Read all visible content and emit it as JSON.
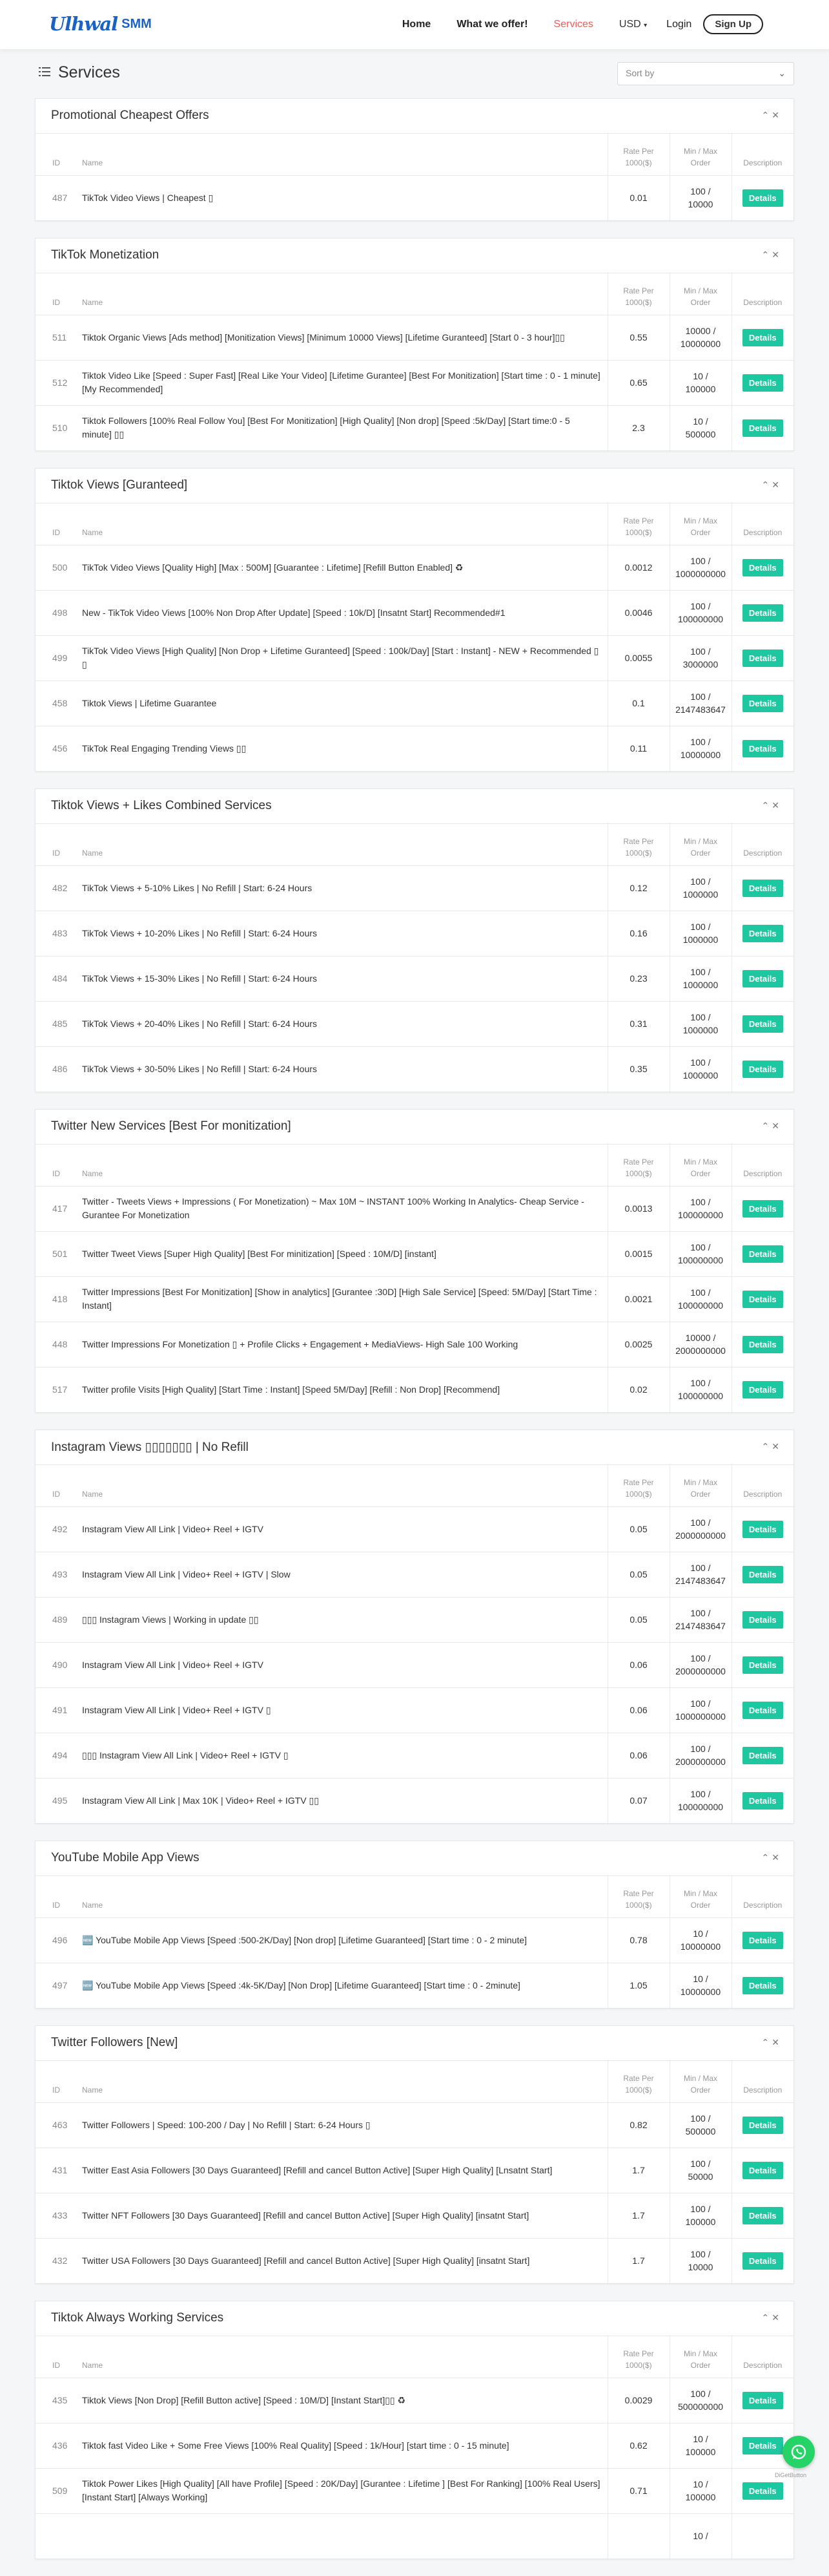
{
  "brand": {
    "script": "Ulhwal",
    "suffix": "SMM",
    "color": "#1b62c4"
  },
  "nav": {
    "home": "Home",
    "offer": "What we offer!",
    "services": "Services",
    "currency": "USD",
    "login": "Login",
    "signup": "Sign Up"
  },
  "page": {
    "title": "Services",
    "sort_placeholder": "Sort by"
  },
  "columns": {
    "id": "ID",
    "name": "Name",
    "rate": "Rate Per 1000($)",
    "minmax": "Min / Max Order",
    "desc": "Description"
  },
  "details_label": "Details",
  "colors": {
    "accent": "#1ec79f",
    "active_nav": "#f05a5a",
    "whatsapp": "#25d366"
  },
  "whatsapp_caption": "DiGetButton",
  "categories": [
    {
      "title": "Promotional Cheapest Offers",
      "rows": [
        {
          "id": "487",
          "name": "TikTok Video Views | Cheapest ▯",
          "rate": "0.01",
          "min": "100 /",
          "max": "10000"
        }
      ]
    },
    {
      "title": "TikTok Monetization",
      "rows": [
        {
          "id": "511",
          "name": "Tiktok Organic Views [Ads method] [Monitization Views] [Minimum 10000 Views] [Lifetime Guranteed] [Start 0 - 3 hour]▯▯",
          "rate": "0.55",
          "min": "10000 /",
          "max": "10000000"
        },
        {
          "id": "512",
          "name": "Tiktok Video Like [Speed : Super Fast] [Real Like Your Video] [Lifetime Gurantee] [Best For Monitization] [Start time : 0 - 1 minute] [My Recommended]",
          "rate": "0.65",
          "min": "10 /",
          "max": "100000"
        },
        {
          "id": "510",
          "name": "Tiktok Followers [100% Real Follow You] [Best For Monitization] [High Quality] [Non drop] [Speed :5k/Day] [Start time:0 - 5 minute] ▯▯",
          "rate": "2.3",
          "min": "10 /",
          "max": "500000"
        }
      ]
    },
    {
      "title": "Tiktok Views [Guranteed]",
      "rows": [
        {
          "id": "500",
          "name": "TikTok Video Views [Quality High] [Max : 500M] [Guarantee : Lifetime] [Refill Button Enabled] ♻",
          "rate": "0.0012",
          "min": "100 /",
          "max": "1000000000"
        },
        {
          "id": "498",
          "name": "New - TikTok Video Views [100% Non Drop After Update] [Speed : 10k/D] [Insatnt Start] Recommended#1",
          "rate": "0.0046",
          "min": "100 /",
          "max": "100000000"
        },
        {
          "id": "499",
          "name": "TikTok Video Views [High Quality] [Non Drop + Lifetime Guranteed] [Speed : 100k/Day] [Start : Instant] - NEW + Recommended ▯ ▯",
          "rate": "0.0055",
          "min": "100 /",
          "max": "3000000"
        },
        {
          "id": "458",
          "name": "Tiktok Views | Lifetime Guarantee",
          "rate": "0.1",
          "min": "100 /",
          "max": "2147483647"
        },
        {
          "id": "456",
          "name": "TikTok Real Engaging Trending Views ▯▯",
          "rate": "0.11",
          "min": "100 /",
          "max": "10000000"
        }
      ]
    },
    {
      "title": "Tiktok Views + Likes Combined Services",
      "rows": [
        {
          "id": "482",
          "name": "TikTok Views + 5-10% Likes | No Refill | Start: 6-24 Hours",
          "rate": "0.12",
          "min": "100 /",
          "max": "1000000"
        },
        {
          "id": "483",
          "name": "TikTok Views + 10-20% Likes | No Refill | Start: 6-24 Hours",
          "rate": "0.16",
          "min": "100 /",
          "max": "1000000"
        },
        {
          "id": "484",
          "name": "TikTok Views + 15-30% Likes | No Refill | Start: 6-24 Hours",
          "rate": "0.23",
          "min": "100 /",
          "max": "1000000"
        },
        {
          "id": "485",
          "name": "TikTok Views + 20-40% Likes | No Refill | Start: 6-24 Hours",
          "rate": "0.31",
          "min": "100 /",
          "max": "1000000"
        },
        {
          "id": "486",
          "name": "TikTok Views + 30-50% Likes | No Refill | Start: 6-24 Hours",
          "rate": "0.35",
          "min": "100 /",
          "max": "1000000"
        }
      ]
    },
    {
      "title": "Twitter New Services [Best For monitization]",
      "rows": [
        {
          "id": "417",
          "name": "Twitter - Tweets Views + Impressions ( For Monetization) ~ Max 10M ~ INSTANT 100% Working In Analytics- Cheap Service - Gurantee For Monetization",
          "rate": "0.0013",
          "min": "100 /",
          "max": "100000000"
        },
        {
          "id": "501",
          "name": "Twitter Tweet Views [Super High Quality] [Best For minitization] [Speed : 10M/D] [instant]",
          "rate": "0.0015",
          "min": "100 /",
          "max": "100000000"
        },
        {
          "id": "418",
          "name": "Twitter Impressions [Best For Monitization] [Show in analytics] [Gurantee :30D] [High Sale Service] [Speed: 5M/Day] [Start Time : Instant]",
          "rate": "0.0021",
          "min": "100 /",
          "max": "100000000"
        },
        {
          "id": "448",
          "name": "Twitter Impressions For Monetization ▯ + Profile Clicks + Engagement + MediaViews- High Sale 100 Working",
          "rate": "0.0025",
          "min": "10000 /",
          "max": "2000000000"
        },
        {
          "id": "517",
          "name": "Twitter profile Visits [High Quality] [Start Time : Instant] [Speed 5M/Day] [Refill : Non Drop] [Recommend]",
          "rate": "0.02",
          "min": "100 /",
          "max": "100000000"
        }
      ]
    },
    {
      "title": "Instagram Views ▯▯▯▯▯▯▯ | No Refill",
      "rows": [
        {
          "id": "492",
          "name": "Instagram View All Link | Video+ Reel + IGTV",
          "rate": "0.05",
          "min": "100 /",
          "max": "2000000000"
        },
        {
          "id": "493",
          "name": "Instagram View All Link | Video+ Reel + IGTV | Slow",
          "rate": "0.05",
          "min": "100 /",
          "max": "2147483647"
        },
        {
          "id": "489",
          "name": "▯▯▯ Instagram Views | Working in update ▯▯",
          "rate": "0.05",
          "min": "100 /",
          "max": "2147483647"
        },
        {
          "id": "490",
          "name": "Instagram View All Link | Video+ Reel + IGTV",
          "rate": "0.06",
          "min": "100 /",
          "max": "2000000000"
        },
        {
          "id": "491",
          "name": "Instagram View All Link | Video+ Reel + IGTV ▯",
          "rate": "0.06",
          "min": "100 /",
          "max": "1000000000"
        },
        {
          "id": "494",
          "name": "▯▯▯ Instagram View All Link | Video+ Reel + IGTV ▯",
          "rate": "0.06",
          "min": "100 /",
          "max": "2000000000"
        },
        {
          "id": "495",
          "name": "Instagram View All Link | Max 10K | Video+ Reel + IGTV ▯▯",
          "rate": "0.07",
          "min": "100 /",
          "max": "100000000"
        }
      ]
    },
    {
      "title": "YouTube Mobile App Views",
      "rows": [
        {
          "id": "496",
          "name": "🆕 YouTube Mobile App Views [Speed :500-2K/Day] [Non drop] [Lifetime Guaranteed] [Start time : 0 - 2 minute]",
          "rate": "0.78",
          "min": "10 /",
          "max": "10000000"
        },
        {
          "id": "497",
          "name": "🆕 YouTube Mobile App Views [Speed :4k-5K/Day] [Non Drop] [Lifetime Guaranteed] [Start time : 0 - 2minute]",
          "rate": "1.05",
          "min": "10 /",
          "max": "10000000"
        }
      ]
    },
    {
      "title": "Twitter Followers [New]",
      "rows": [
        {
          "id": "463",
          "name": "Twitter Followers | Speed: 100-200 / Day | No Refill | Start: 6-24 Hours ▯",
          "rate": "0.82",
          "min": "100 /",
          "max": "500000"
        },
        {
          "id": "431",
          "name": "Twitter East Asia Followers [30 Days Guaranteed] [Refill and cancel Button Active] [Super High Quality] [Lnsatnt Start]",
          "rate": "1.7",
          "min": "100 /",
          "max": "50000"
        },
        {
          "id": "433",
          "name": "Twitter NFT Followers [30 Days Guaranteed] [Refill and cancel Button Active] [Super High Quality] [insatnt Start]",
          "rate": "1.7",
          "min": "100 /",
          "max": "100000"
        },
        {
          "id": "432",
          "name": "Twitter USA Followers [30 Days Guaranteed] [Refill and cancel Button Active] [Super High Quality] [insatnt Start]",
          "rate": "1.7",
          "min": "100 /",
          "max": "10000"
        }
      ]
    },
    {
      "title": "Tiktok Always Working Services",
      "rows": [
        {
          "id": "435",
          "name": "Tiktok Views [Non Drop] [Refill Button active] [Speed : 10M/D] [Instant Start]▯▯ ♻",
          "rate": "0.0029",
          "min": "100 /",
          "max": "500000000"
        },
        {
          "id": "436",
          "name": "Tiktok fast Video Like + Some Free Views [100% Real Quality] [Speed : 1k/Hour] [start time : 0 - 15 minute]",
          "rate": "0.62",
          "min": "10 /",
          "max": "100000"
        },
        {
          "id": "509",
          "name": "Tiktok Power Likes [High Quality] [All have Profile] [Speed : 20K/Day] [Gurantee : Lifetime ] [Best For Ranking] [100% Real Users] [Instant Start] [Always Working]",
          "rate": "0.71",
          "min": "10 /",
          "max": "100000"
        },
        {
          "id": "",
          "name": "",
          "rate": "",
          "min": "10 /",
          "max": ""
        }
      ]
    }
  ]
}
